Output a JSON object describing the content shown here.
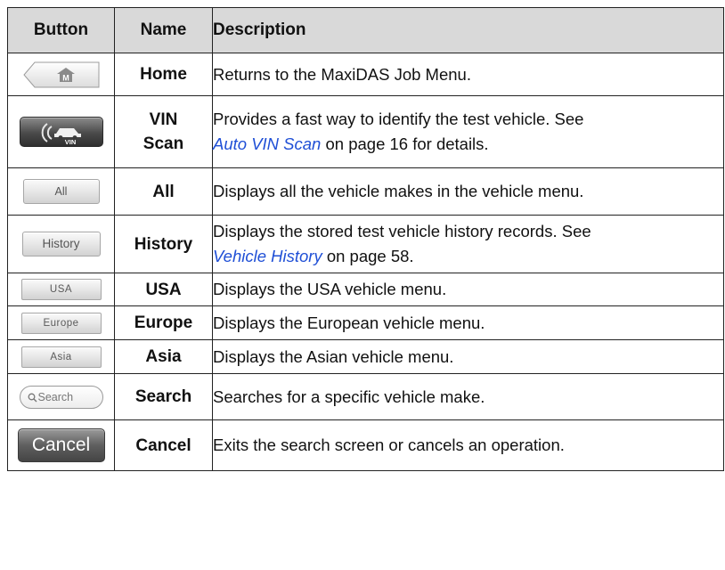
{
  "header": {
    "button": "Button",
    "name": "Name",
    "description": "Description"
  },
  "rows": [
    {
      "icon": "home-icon",
      "name": "Home",
      "desc": "Returns to the MaxiDAS Job Menu."
    },
    {
      "icon": "vin-scan-icon",
      "name_line1": "VIN",
      "name_line2": "Scan",
      "desc_line1": "Provides a fast way to identify the test vehicle. See",
      "desc_link": "Auto VIN Scan",
      "desc_after": " on page 16 for details."
    },
    {
      "button_text": "All",
      "name": "All",
      "desc": "Displays all the vehicle makes in the vehicle menu."
    },
    {
      "button_text": "History",
      "name": "History",
      "desc_line1": "Displays the stored test vehicle history records. See",
      "desc_link": "Vehicle History",
      "desc_after": " on page 58."
    },
    {
      "button_text": "USA",
      "name": "USA",
      "desc": "Displays the USA vehicle menu."
    },
    {
      "button_text": "Europe",
      "name": "Europe",
      "desc": "Displays the European vehicle menu."
    },
    {
      "button_text": "Asia",
      "name": "Asia",
      "desc": "Displays the Asian vehicle menu."
    },
    {
      "button_text": "Search",
      "icon": "magnifier-icon",
      "name": "Search",
      "desc": "Searches for a specific vehicle make."
    },
    {
      "button_text": "Cancel",
      "name": "Cancel",
      "desc": "Exits the search screen or cancels an operation."
    }
  ],
  "colors": {
    "header_bg": "#d9d9d9",
    "link": "#1f4fd6",
    "border": "#222222"
  }
}
